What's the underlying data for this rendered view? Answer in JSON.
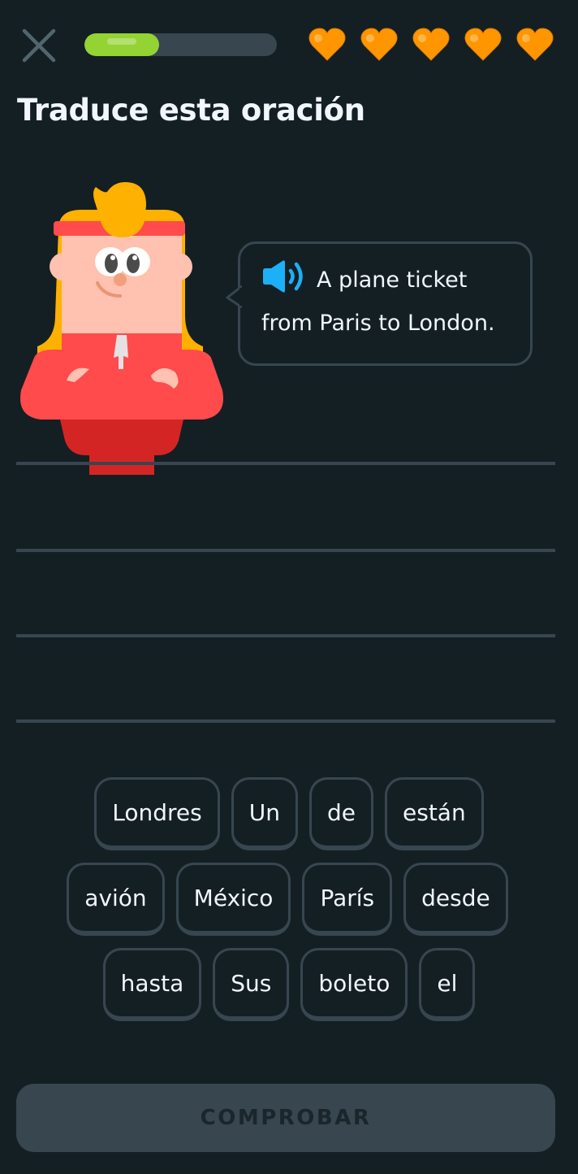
{
  "header": {
    "close_icon": "close-x-icon",
    "progress": 0.39,
    "hearts_count": 5,
    "colors": {
      "progress_fill": "#93d333",
      "progress_track": "#37464f",
      "heart": "#ff9600"
    }
  },
  "exercise": {
    "title": "Traduce esta oración",
    "prompt": {
      "speaker_icon": "speaker-audio-icon",
      "line1": "A plane ticket",
      "line2": "from Paris to London."
    },
    "character": "duo-character-headband"
  },
  "word_bank": {
    "rows": [
      [
        "Londres",
        "Un",
        "de",
        "están"
      ],
      [
        "avión",
        "México",
        "París",
        "desde"
      ],
      [
        "hasta",
        "Sus",
        "boleto",
        "el"
      ]
    ]
  },
  "footer": {
    "check_label": "COMPROBAR",
    "check_enabled": false
  },
  "theme": {
    "background": "#141f24",
    "border": "#37464f",
    "text": "#f1f7fb",
    "accent_blue": "#1cb0f6"
  }
}
